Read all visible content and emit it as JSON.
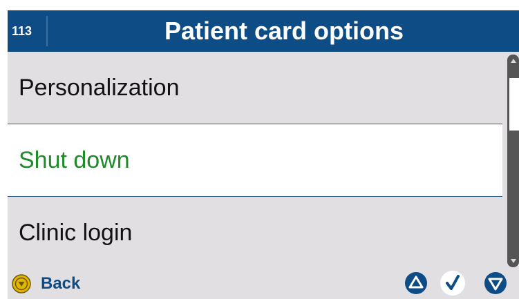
{
  "header": {
    "screen_number": "113",
    "title": "Patient card options"
  },
  "menu": {
    "items": [
      {
        "label": "Personalization",
        "selected": false
      },
      {
        "label": "Shut down",
        "selected": true
      },
      {
        "label": "Clinic login",
        "selected": false
      }
    ]
  },
  "footer": {
    "back_label": "Back",
    "back_icon": "back-circle-icon",
    "nav_up_icon": "triangle-up-icon",
    "confirm_icon": "checkmark-icon",
    "nav_down_icon": "triangle-down-icon"
  },
  "colors": {
    "header_background": "#0e4c86",
    "list_background": "#e2dfe3",
    "selected_background": "#ffffff",
    "selected_text": "#1f8a28",
    "back_icon": "#e3b500",
    "nav_icons": "#0e4c86"
  }
}
